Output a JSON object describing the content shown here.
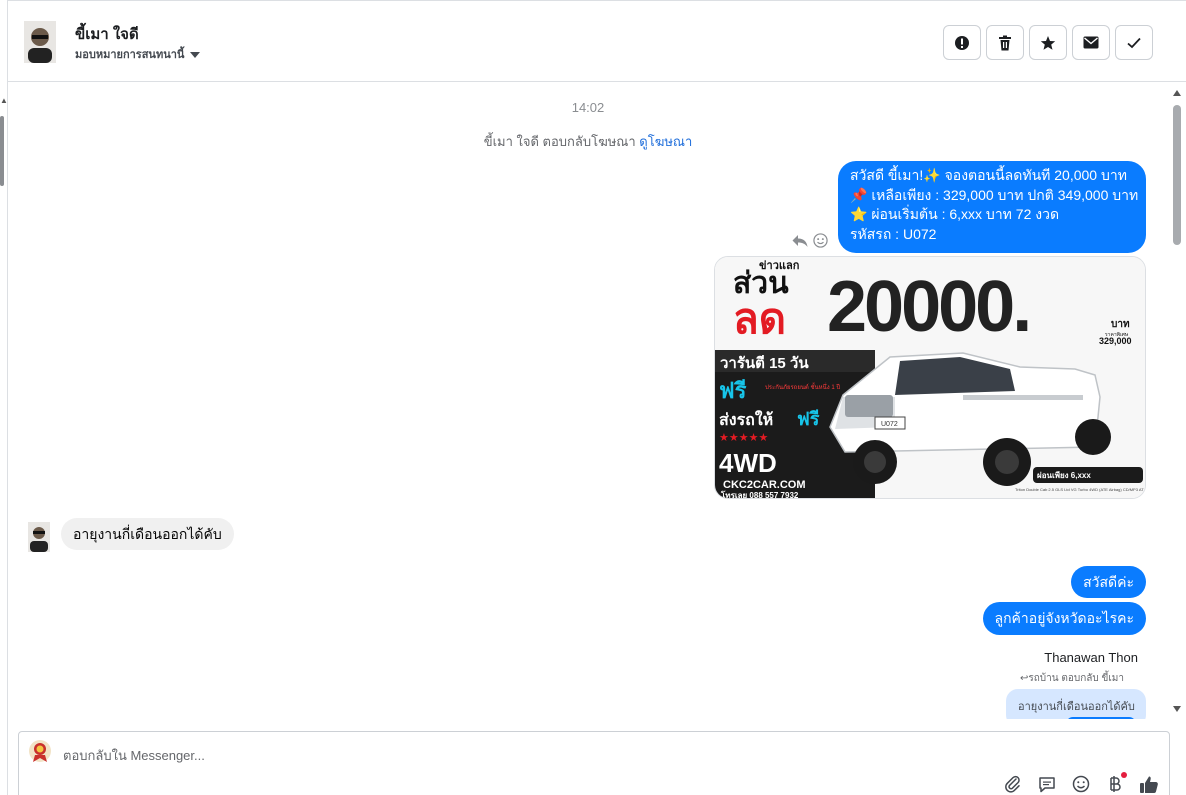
{
  "contact": {
    "name": "ขี้เมา ใจดี",
    "assign_label": "มอบหมายการสนทนานี้"
  },
  "header_actions": [
    {
      "name": "spam-button",
      "icon": "alert-icon"
    },
    {
      "name": "delete-button",
      "icon": "trash-icon"
    },
    {
      "name": "star-button",
      "icon": "star-icon"
    },
    {
      "name": "mark-unread-button",
      "icon": "mail-icon"
    },
    {
      "name": "done-button",
      "icon": "check-icon"
    }
  ],
  "thread": {
    "timestamp": "14:02",
    "ad_reply_text": "ขี้เมา ใจดี ตอบกลับโฆษณา ",
    "ad_reply_link": "ดูโฆษณา",
    "outgoing_first": {
      "line1": "สวัสดี ขี้เมา!✨ จองตอนนี้ลดทันที 20,000 บาท",
      "line2": "📌 เหลือเพียง : 329,000 บาท ปกติ 349,000 บาท",
      "line3": "⭐ ผ่อนเริ่มต้น : 6,xxx บาท 72 งวด",
      "line4": "รหัสรถ : U072"
    },
    "ad_image": {
      "top_small": "ข่าวแลก",
      "headline_left": "ส่วน",
      "headline_red": "ลด",
      "headline_number": "20000.",
      "unit": "บาท",
      "old_price_label": "ราคาพิเศษ",
      "price": "329,000",
      "warranty": "วารันตี 15 วัน",
      "free1": "ฟรี",
      "free1_note": "ประกันภัยรถยนต์ ชั้นหนึ่ง 1 ปี",
      "delivery": "ส่งรถให้",
      "free2": "ฟรี",
      "stars": "★★★★★",
      "drive": "4WD",
      "website": "CKC2CAR.COM",
      "phone": "โทรเลย 088 557 7932",
      "plate": "U072",
      "installment": "ผ่อนเพียง 6,xxx",
      "model": "Triton Double Cab 2.5 GLS Ltd VG Turbo 4WD (ATE Airbag) CD/MP3 AT"
    },
    "incoming_first": "อายุงานกี่เดือนออกได้คับ",
    "outgoing_second": "สวัสดีค่ะ",
    "outgoing_third": "ลูกค้าอยู่จังหวัดอะไรคะ",
    "sender_name": "Thanawan Thon",
    "reply_label": "↩รถบ้าน ตอบกลับ ขี้เมา",
    "quoted_text": "อายุงานกี่เดือนออกได้คับ"
  },
  "composer": {
    "placeholder": "ตอบกลับใน Messenger..."
  },
  "colors": {
    "outgoing_bubble": "#0a7cff",
    "incoming_bubble": "#f0f0f0",
    "link": "#216fdb"
  }
}
